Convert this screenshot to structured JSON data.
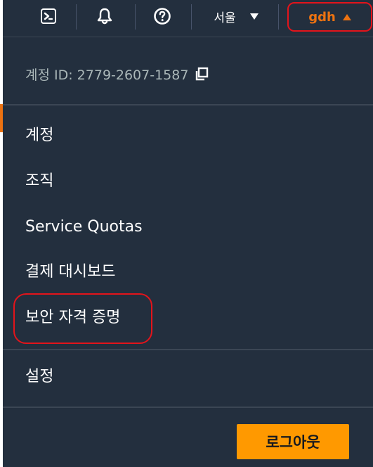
{
  "topbar": {
    "cloudshell_icon": "cloudshell-icon",
    "notifications_icon": "bell-icon",
    "help_icon": "help-circle-icon",
    "region_label": "서울",
    "user_label": "gdh"
  },
  "dropdown": {
    "account_id_text": "계정 ID: 2779-2607-1587",
    "items": [
      {
        "label": "계정"
      },
      {
        "label": "조직"
      },
      {
        "label": "Service Quotas"
      },
      {
        "label": "결제 대시보드"
      },
      {
        "label": "보안 자격 증명"
      }
    ],
    "settings_label": "설정",
    "logout_label": "로그아웃"
  },
  "colors": {
    "background": "#232f3e",
    "accent_orange": "#ec7211",
    "button_orange": "#ff9900",
    "highlight_red": "#e3141b"
  }
}
